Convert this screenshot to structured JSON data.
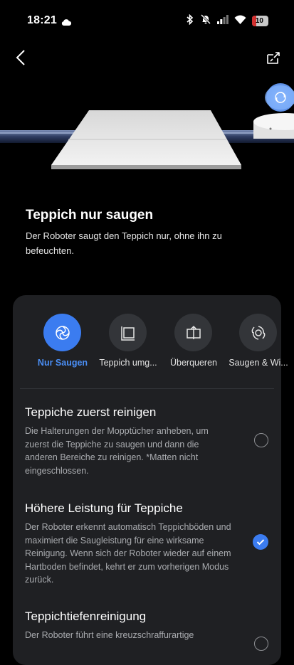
{
  "status_bar": {
    "time": "18:21",
    "battery": "10"
  },
  "intro": {
    "title": "Teppich nur saugen",
    "description": "Der Roboter saugt den Teppich nur, ohne ihn zu befeuchten."
  },
  "modes": [
    {
      "label": "Nur Saugen",
      "active": true
    },
    {
      "label": "Teppich umg...",
      "active": false
    },
    {
      "label": "Überqueren",
      "active": false
    },
    {
      "label": "Saugen & Wi...",
      "active": false
    }
  ],
  "options": [
    {
      "title": "Teppiche zuerst reinigen",
      "description": "Die Halterungen der Mopptücher anheben, um zuerst die Teppiche zu saugen und dann die anderen Bereiche zu reinigen. *Matten nicht eingeschlossen.",
      "selected": false
    },
    {
      "title": "Höhere Leistung für Teppiche",
      "description": "Der Roboter erkennt automatisch Teppichböden und maximiert die Saugleistung für eine wirksame Reinigung. Wenn sich der Roboter wieder auf einem Hartboden befindet, kehrt er zum vorherigen Modus zurück.",
      "selected": true
    },
    {
      "title": "Teppichtiefenreinigung",
      "description": "Der Roboter führt eine kreuzschraffurartige",
      "selected": false
    }
  ],
  "colors": {
    "accent": "#3b7cf0",
    "panel": "#1f2023",
    "background": "#000000"
  }
}
